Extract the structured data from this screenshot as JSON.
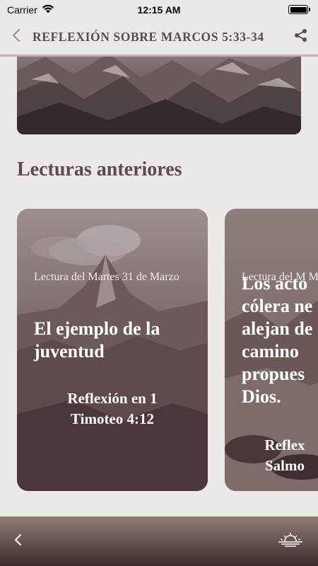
{
  "status": {
    "carrier": "Carrier",
    "time": "12:15 AM"
  },
  "header": {
    "title": "REFLEXIÓN SOBRE MARCOS 5:33-34"
  },
  "section": {
    "title": "Lecturas anteriores"
  },
  "cards": [
    {
      "date": "Lectura del Martes 31 de Marzo",
      "title": "El ejemplo de la juventud",
      "reference": "Reflexión en 1 Timoteo 4:12"
    },
    {
      "date": "Lectura del M Marzo",
      "title": "Los acto cólera ne alejan de camino propues Dios.",
      "reference": "Reflex Salmo"
    }
  ],
  "colors": {
    "accent": "#c8adb5",
    "text": "#5b4a4e",
    "background": "#ebe9e6"
  },
  "icons": [
    "wifi-icon",
    "battery-icon",
    "back-chevron-icon",
    "share-icon",
    "sunrise-icon"
  ]
}
